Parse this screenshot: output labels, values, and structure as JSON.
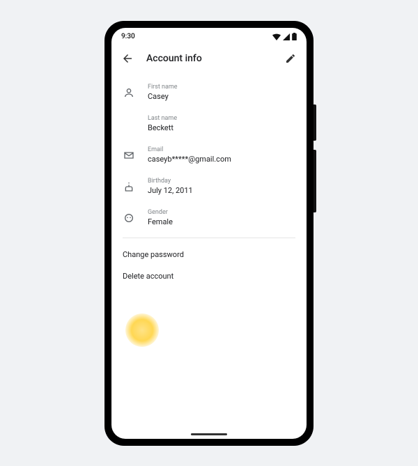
{
  "statusBar": {
    "time": "9:30"
  },
  "appBar": {
    "title": "Account info"
  },
  "fields": {
    "firstName": {
      "label": "First name",
      "value": "Casey"
    },
    "lastName": {
      "label": "Last name",
      "value": "Beckett"
    },
    "email": {
      "label": "Email",
      "value": "caseyb*****@gmail.com"
    },
    "birthday": {
      "label": "Birthday",
      "value": "July 12, 2011"
    },
    "gender": {
      "label": "Gender",
      "value": "Female"
    }
  },
  "actions": {
    "changePassword": "Change password",
    "deleteAccount": "Delete account"
  }
}
